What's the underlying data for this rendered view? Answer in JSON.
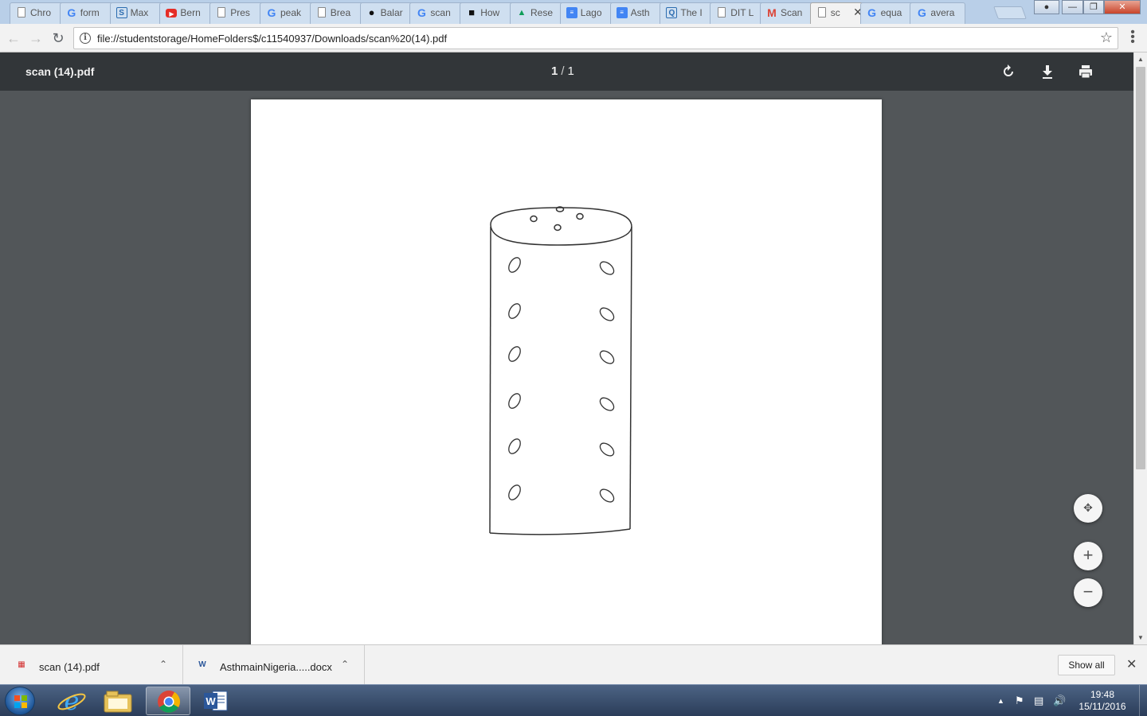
{
  "tabs": [
    {
      "title": "Chro",
      "favicon": "doc-icon"
    },
    {
      "title": "form",
      "favicon": "google-icon"
    },
    {
      "title": "Max",
      "favicon": "mendeley-icon"
    },
    {
      "title": "Bern",
      "favicon": "youtube-icon"
    },
    {
      "title": "Pres",
      "favicon": "doc-icon"
    },
    {
      "title": "peak",
      "favicon": "google-icon"
    },
    {
      "title": "Brea",
      "favicon": "slides-icon"
    },
    {
      "title": "Balar",
      "favicon": "dark-icon"
    },
    {
      "title": "scan",
      "favicon": "google-icon"
    },
    {
      "title": "How",
      "favicon": "image-icon"
    },
    {
      "title": "Rese",
      "favicon": "drive-icon"
    },
    {
      "title": "Lago",
      "favicon": "gdoc-icon"
    },
    {
      "title": "Asth",
      "favicon": "gdoc-icon"
    },
    {
      "title": "The I",
      "favicon": "q-icon"
    },
    {
      "title": "DIT L",
      "favicon": "doc-icon"
    },
    {
      "title": "Scan",
      "favicon": "gmail-icon"
    },
    {
      "title": "sc",
      "favicon": "doc-icon",
      "active": true
    },
    {
      "title": "equa",
      "favicon": "google-icon"
    },
    {
      "title": "avera",
      "favicon": "google-icon"
    }
  ],
  "address_bar": {
    "url": "file://studentstorage/HomeFolders$/c11540937/Downloads/scan%20(14).pdf"
  },
  "pdf_viewer": {
    "title": "scan (14).pdf",
    "current_page": "1",
    "separator": "/",
    "total_pages": "1"
  },
  "downloads": [
    {
      "name": "scan (14).pdf",
      "icon": "pdf-file-icon"
    },
    {
      "name": "AsthmainNigeria.....docx",
      "icon": "word-file-icon"
    }
  ],
  "shelf": {
    "show_all": "Show all"
  },
  "taskbar": {
    "apps": [
      "windows-start",
      "internet-explorer",
      "file-explorer",
      "chrome",
      "word"
    ],
    "time": "19:48",
    "date": "15/11/2016"
  },
  "colors": {
    "viewer_bg": "#525659",
    "viewer_toolbar": "#323639",
    "tabstrip": "#b9cfe8"
  }
}
